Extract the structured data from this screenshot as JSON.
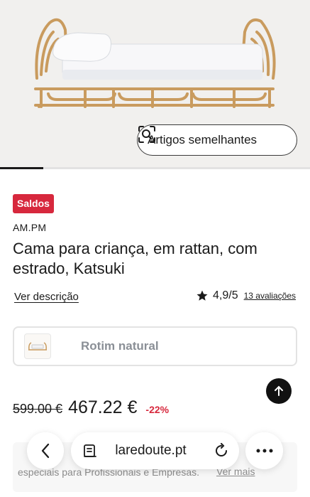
{
  "hero": {
    "similar_label": "Artigos semelhantes",
    "gallery_progress": 0.14
  },
  "product": {
    "badge": "Saldos",
    "brand": "AM.PM",
    "title": "Cama para criança, em rattan, com estrado, Katsuki",
    "description_link": "Ver descrição",
    "rating": "4,9/5",
    "reviews": "13 avaliações",
    "variant_label": "Rotim natural",
    "old_price": "599.00 €",
    "new_price": "467.22 €",
    "discount": "-22%"
  },
  "promo": {
    "text": "especiais para Profissionais e Empresas.",
    "link": "Ver mais",
    "partial": "si"
  },
  "browser": {
    "url": "laredoute.pt"
  },
  "colors": {
    "sale_red": "#d7283d",
    "text": "#1a1a1a",
    "muted": "#8a8f96"
  },
  "icons": [
    "visual-search-icon",
    "star-icon",
    "arrow-up-icon",
    "back-chevron-icon",
    "tab-icon",
    "reload-icon",
    "more-icon"
  ]
}
